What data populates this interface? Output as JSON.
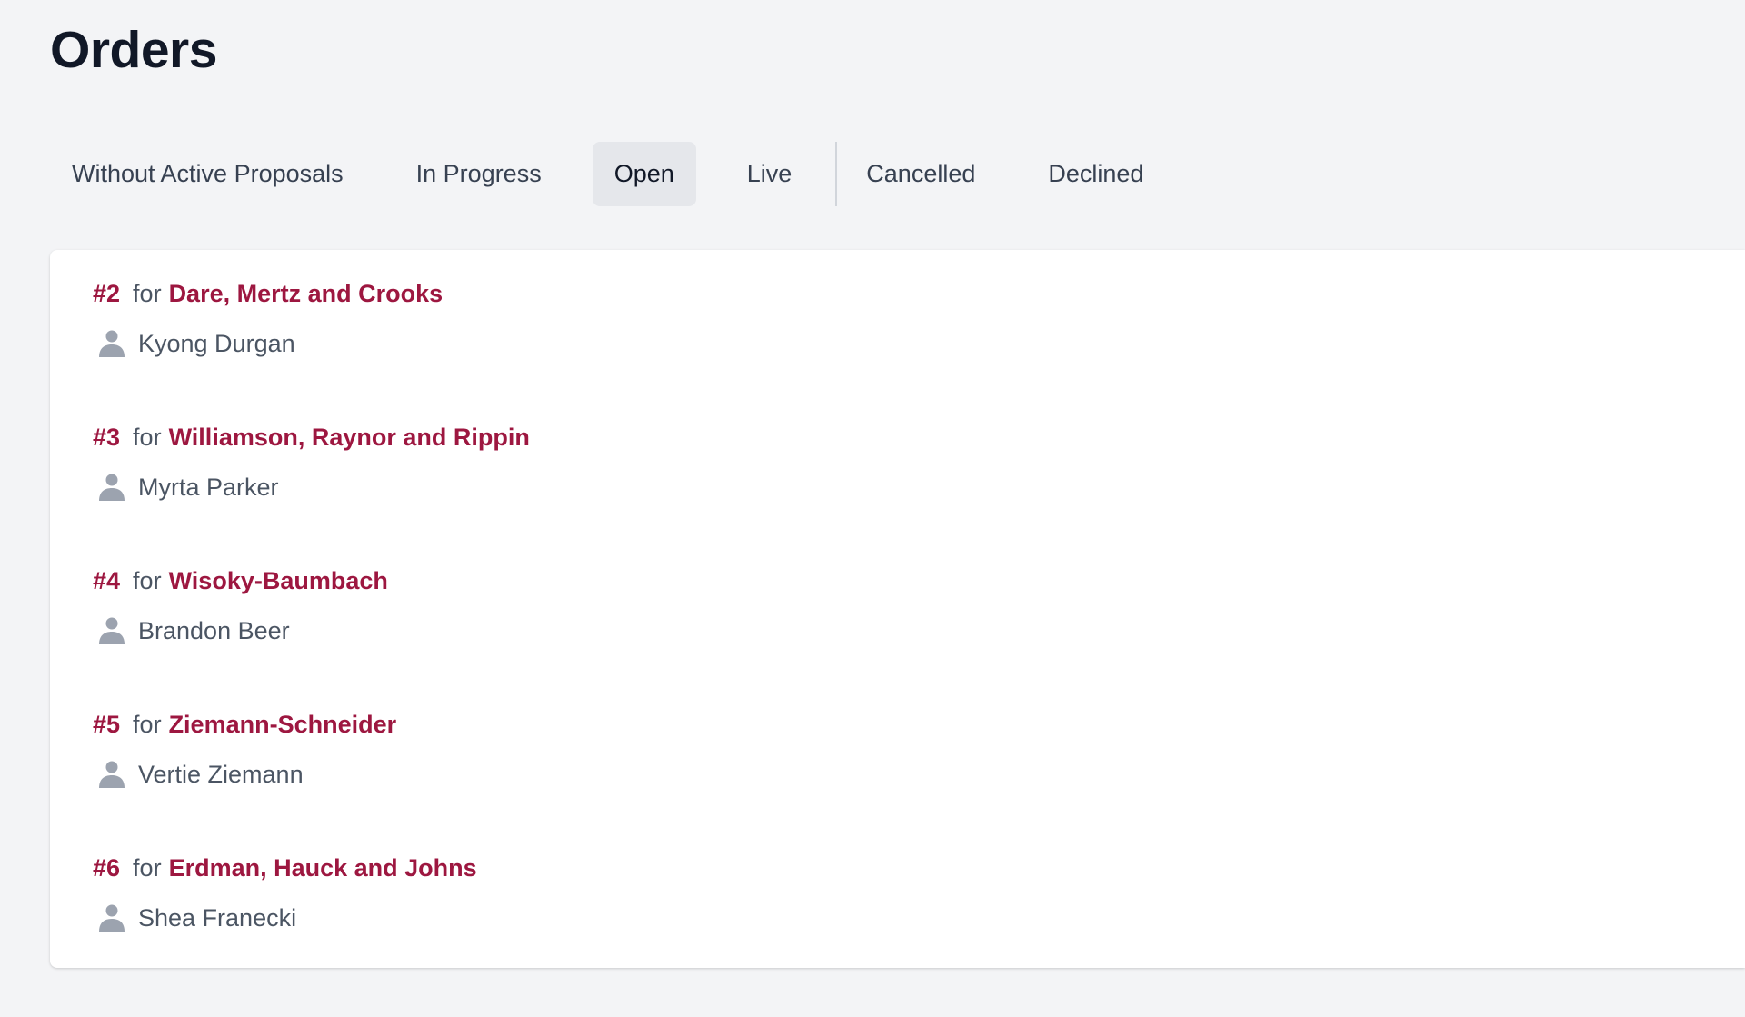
{
  "header": {
    "title": "Orders"
  },
  "tabs": [
    {
      "label": "Without Active Proposals",
      "active": false
    },
    {
      "label": "In Progress",
      "active": false
    },
    {
      "label": "Open",
      "active": true
    },
    {
      "label": "Live",
      "active": false
    },
    {
      "label": "Cancelled",
      "active": false
    },
    {
      "label": "Declined",
      "active": false
    }
  ],
  "orders": [
    {
      "number": "#2",
      "for_label": "for",
      "company": "Dare, Mertz and Crooks",
      "contact": "Kyong Durgan"
    },
    {
      "number": "#3",
      "for_label": "for",
      "company": "Williamson, Raynor and Rippin",
      "contact": "Myrta Parker"
    },
    {
      "number": "#4",
      "for_label": "for",
      "company": "Wisoky-Baumbach",
      "contact": "Brandon Beer"
    },
    {
      "number": "#5",
      "for_label": "for",
      "company": "Ziemann-Schneider",
      "contact": "Vertie Ziemann"
    },
    {
      "number": "#6",
      "for_label": "for",
      "company": "Erdman, Hauck and Johns",
      "contact": "Shea Franecki"
    }
  ],
  "icons": {
    "contact": "user-icon"
  },
  "colors": {
    "accent": "#9d1740",
    "background": "#f3f4f6",
    "active_tab_bg": "#e5e7eb",
    "muted_text": "#4b5563",
    "icon": "#9ca3af"
  }
}
